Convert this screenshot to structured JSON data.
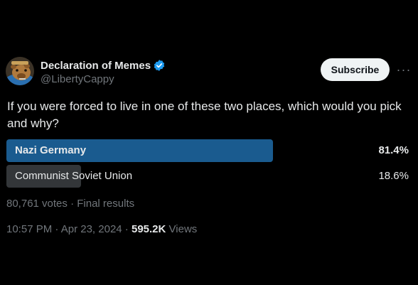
{
  "author": {
    "display_name": "Declaration of Memes",
    "handle": "@LibertyCappy",
    "verified_icon": "verified-badge-icon",
    "avatar_icon": "capybara-avatar-icon"
  },
  "actions": {
    "subscribe_label": "Subscribe",
    "more_icon": "more-icon",
    "more_glyph": "···"
  },
  "tweet": {
    "text": "If you were forced to live in one of these two places, which would you pick and why?"
  },
  "poll": {
    "options": [
      {
        "label": "Nazi Germany",
        "percent_label": "81.4%",
        "fraction": 0.814,
        "winner": true,
        "color": "#1a5b8f"
      },
      {
        "label": "Communist Soviet Union",
        "percent_label": "18.6%",
        "fraction": 0.186,
        "winner": false,
        "color": "#333639"
      }
    ],
    "votes": "80,761 votes",
    "separator": " · ",
    "status": "Final results"
  },
  "meta": {
    "time": "10:57 PM",
    "separator": " · ",
    "date": "Apr 23, 2024",
    "views_count": "595.2K",
    "views_label": "Views"
  },
  "colors": {
    "background": "#000000",
    "text": "#e7e9ea",
    "secondary": "#71767b",
    "verified": "#1d9bf0",
    "winner_fill": "#1a5b8f",
    "loser_fill": "#333639"
  }
}
